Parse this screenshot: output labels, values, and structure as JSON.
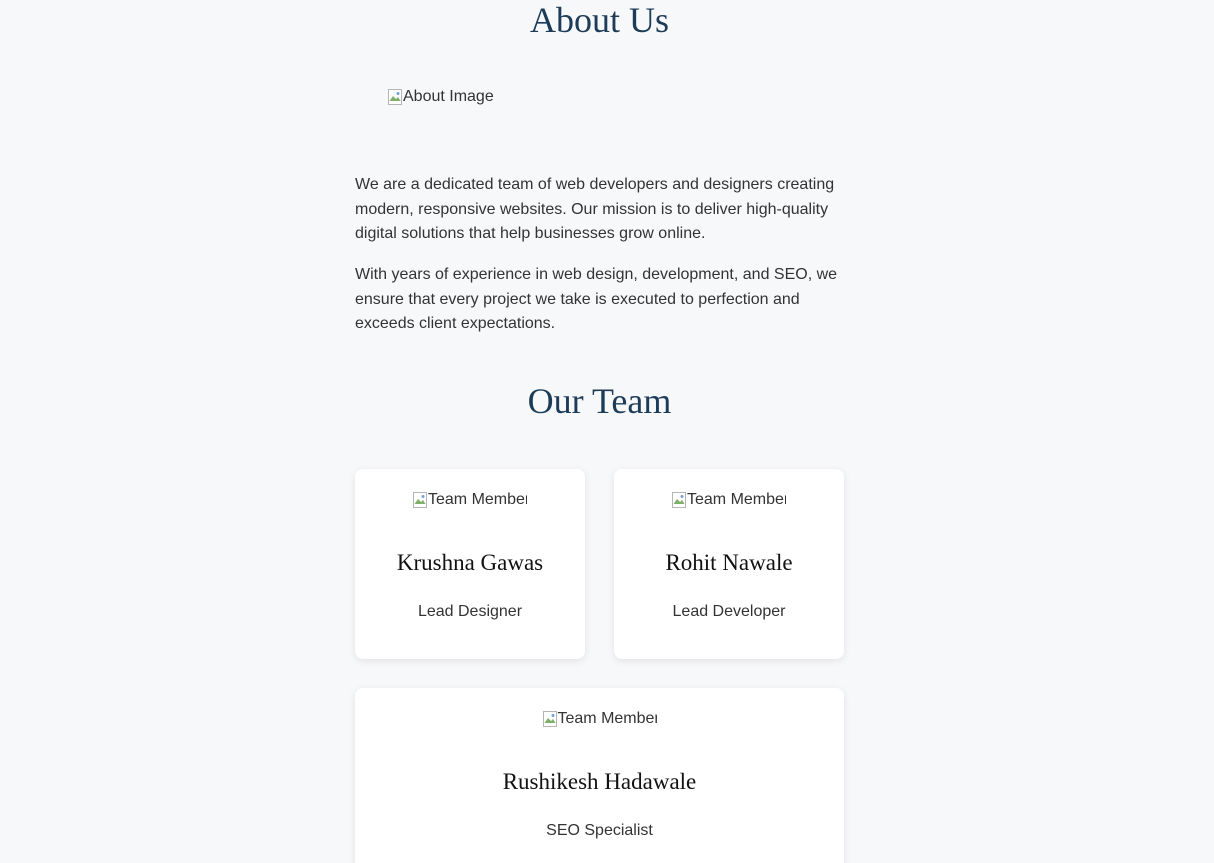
{
  "about": {
    "title": "About Us",
    "image_alt": "About Image",
    "paragraphs": [
      "We are a dedicated team of web developers and designers creating modern, responsive websites. Our mission is to deliver high-quality digital solutions that help businesses grow online.",
      "With years of experience in web design, development, and SEO, we ensure that every project we take is executed to perfection and exceeds client expectations."
    ]
  },
  "team": {
    "title": "Our Team",
    "members": [
      {
        "image_alt": "Team Member",
        "name": "Krushna Gawas",
        "role": "Lead Designer"
      },
      {
        "image_alt": "Team Member",
        "name": "Rohit Nawale",
        "role": "Lead Developer"
      },
      {
        "image_alt": "Team Member",
        "name": "Rushikesh Hadawale",
        "role": "SEO Specialist"
      }
    ]
  },
  "colors": {
    "background": "#f7f8fa",
    "heading": "#1d3c58",
    "text": "#333333",
    "card": "#ffffff"
  }
}
